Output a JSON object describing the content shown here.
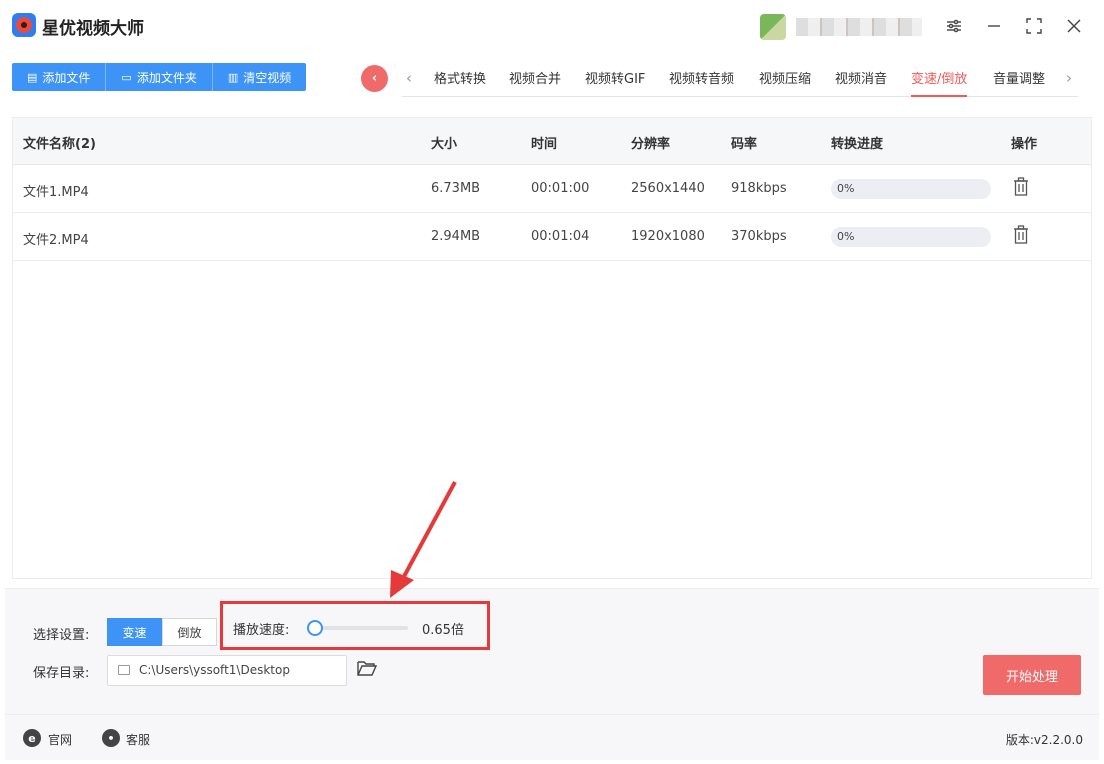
{
  "app": {
    "title": "星优视频大师"
  },
  "window": {
    "settings_icon": "sliders-icon",
    "minimize_icon": "minimize-icon",
    "maximize_icon": "maximize-icon",
    "close_icon": "close-icon"
  },
  "toolbar": {
    "add_file": "添加文件",
    "add_folder": "添加文件夹",
    "clear_video": "清空视频"
  },
  "tabs": {
    "items": [
      "格式转换",
      "视频合并",
      "视频转GIF",
      "视频转音频",
      "视频压缩",
      "视频消音",
      "变速/倒放",
      "音量调整"
    ],
    "active": "变速/倒放"
  },
  "table": {
    "headers": {
      "name": "文件名称(2)",
      "size": "大小",
      "duration": "时间",
      "resolution": "分辨率",
      "bitrate": "码率",
      "progress": "转换进度",
      "action": "操作"
    },
    "rows": [
      {
        "name": "文件1.MP4",
        "size": "6.73MB",
        "duration": "00:01:00",
        "resolution": "2560x1440",
        "bitrate": "918kbps",
        "progress": "0%",
        "progress_value": 0
      },
      {
        "name": "文件2.MP4",
        "size": "2.94MB",
        "duration": "00:01:04",
        "resolution": "1920x1080",
        "bitrate": "370kbps",
        "progress": "0%",
        "progress_value": 0
      }
    ]
  },
  "settings": {
    "mode_label": "选择设置:",
    "mode_options": [
      "变速",
      "倒放"
    ],
    "mode_selected": "变速",
    "speed_label": "播放速度:",
    "speed_value": "0.65倍",
    "speed_slider_fraction": 0.05,
    "save_label": "保存目录:",
    "save_path": "C:\\Users\\yssoft1\\Desktop",
    "start_button": "开始处理"
  },
  "footer": {
    "website": "官网",
    "support": "客服",
    "version": "版本:v2.2.0.0"
  },
  "colors": {
    "primary": "#3d94f6",
    "accent": "#f06a6a",
    "annotation": "#e63a3a"
  }
}
